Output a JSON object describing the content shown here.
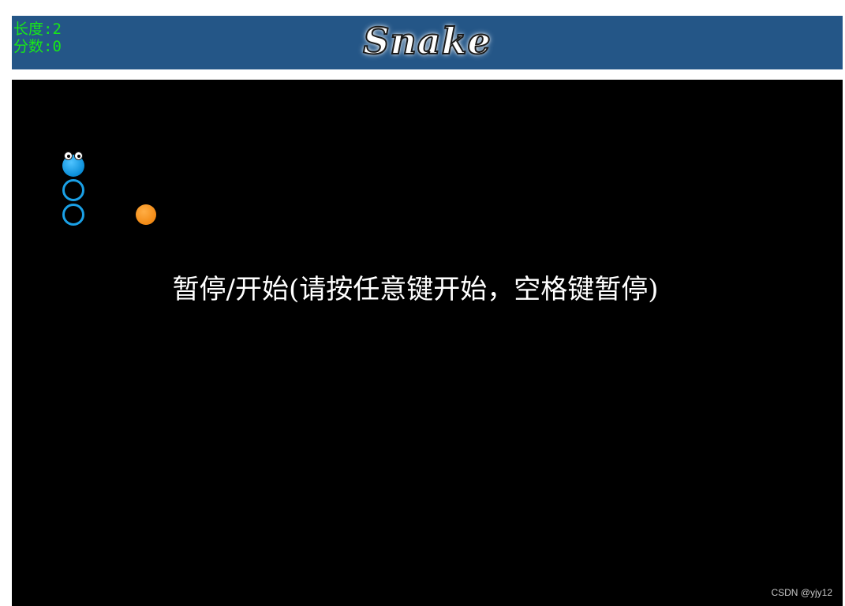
{
  "hud": {
    "length_label": "长度:2",
    "score_label": "分数:0"
  },
  "title": "Snake",
  "board": {
    "message": "暂停/开始(请按任意键开始，空格键暂停)"
  },
  "snake": {
    "head_icon": "snake-head-icon",
    "body_segments": 2
  },
  "food_icon": "food-orb-icon",
  "colors": {
    "header_bg": "#245687",
    "hud_text": "#18e818",
    "board_bg": "#000000",
    "snake": "#1aa0e6",
    "food": "#f28a15"
  },
  "watermark": "CSDN @yjy12"
}
